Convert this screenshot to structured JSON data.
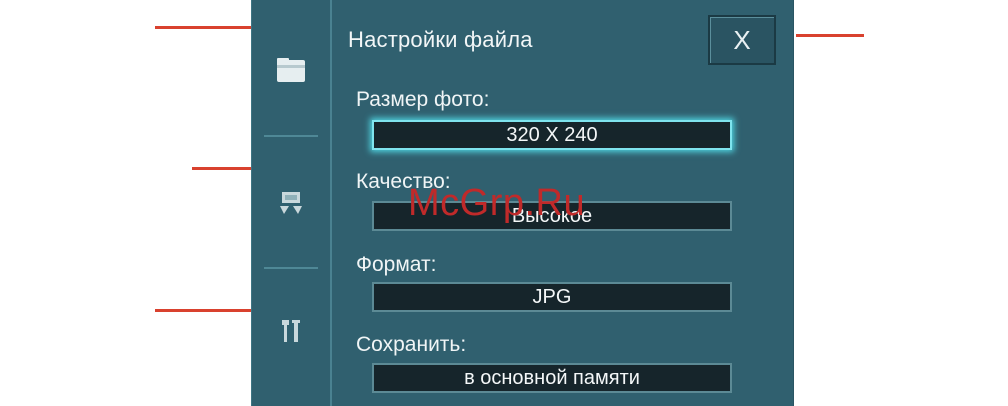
{
  "dialog": {
    "title": "Настройки файла",
    "close_label": "X"
  },
  "sidebar": {
    "items": [
      {
        "icon": "folder-icon"
      },
      {
        "icon": "photo-icon"
      },
      {
        "icon": "tools-icon"
      }
    ]
  },
  "fields": [
    {
      "label": "Размер фото:",
      "value": "320 X 240",
      "focused": true
    },
    {
      "label": "Качество:",
      "value": "Высокое"
    },
    {
      "label": "Формат:",
      "value": "JPG"
    },
    {
      "label": "Сохранить:",
      "value": "в основной памяти"
    }
  ],
  "watermark": "McGrp.Ru",
  "colors": {
    "panel": "#30606f",
    "callout": "#d9412e",
    "focus": "#7fe4ee"
  }
}
